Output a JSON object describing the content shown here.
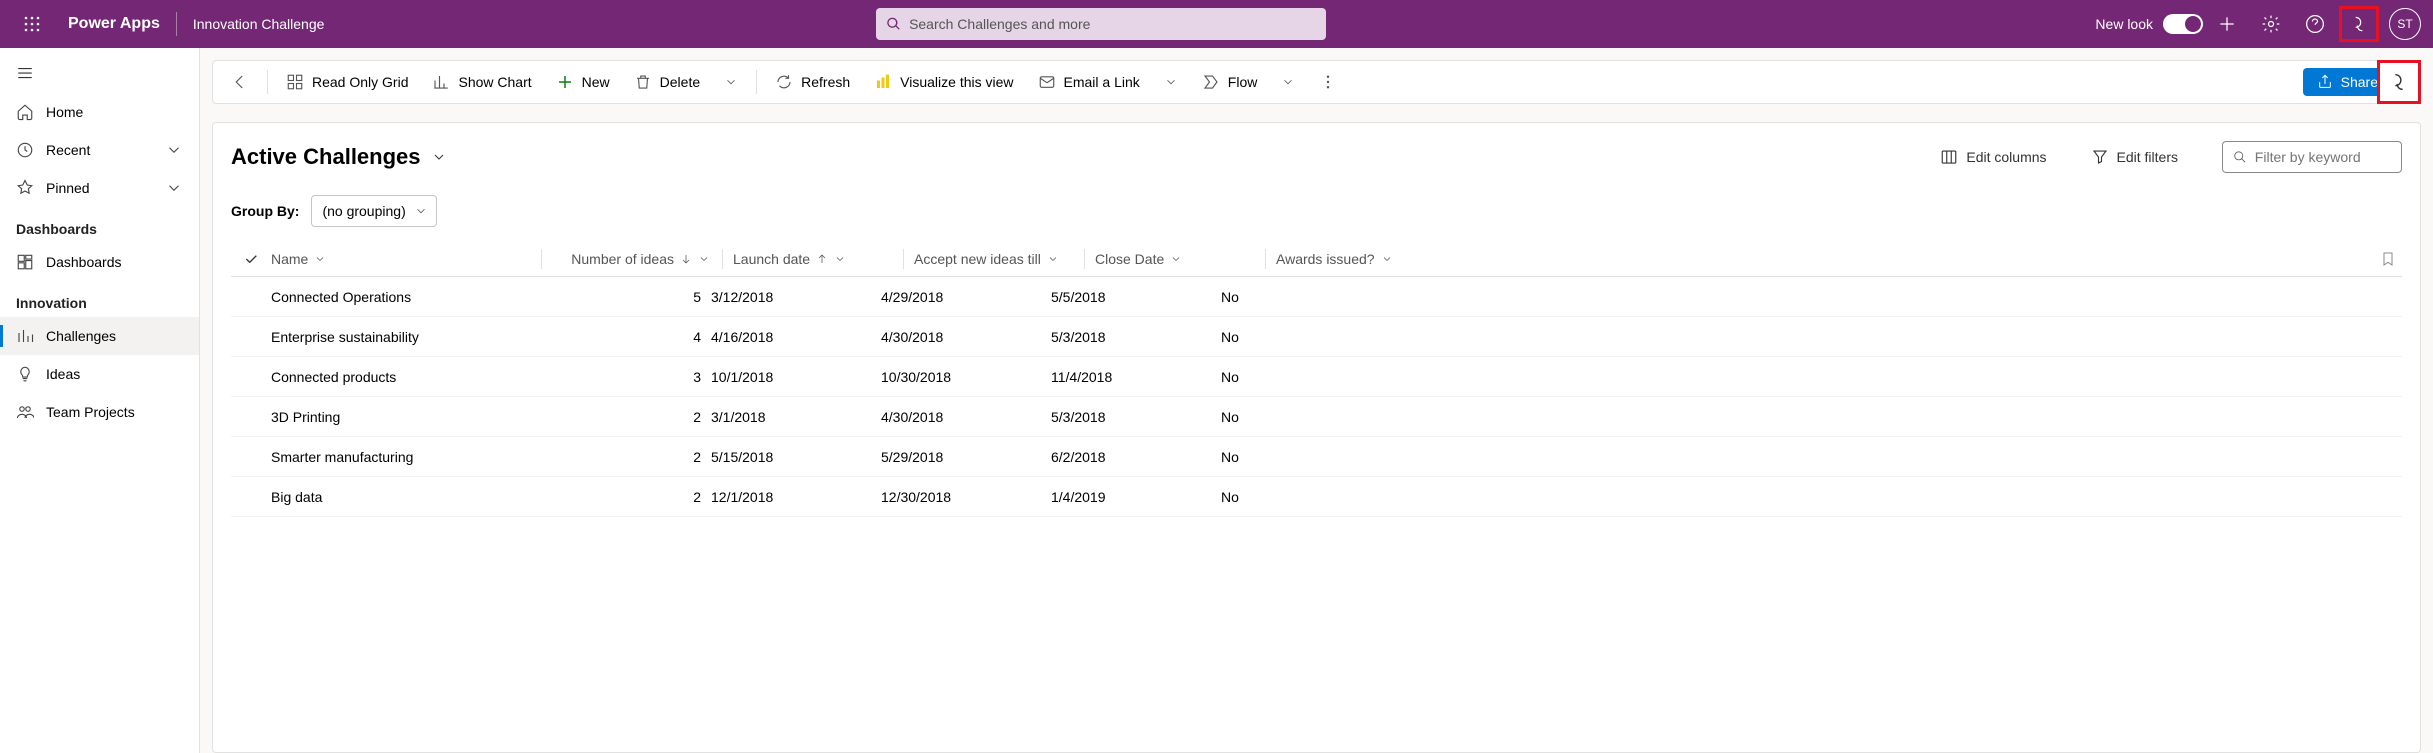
{
  "header": {
    "brand": "Power Apps",
    "app_name": "Innovation Challenge",
    "search_placeholder": "Search Challenges and more",
    "new_look_label": "New look",
    "avatar_initials": "ST"
  },
  "sidebar": {
    "items": [
      {
        "label": "Home"
      },
      {
        "label": "Recent"
      },
      {
        "label": "Pinned"
      }
    ],
    "section_dashboards": "Dashboards",
    "dashboards_item": "Dashboards",
    "section_innovation": "Innovation",
    "innovation_items": [
      {
        "label": "Challenges"
      },
      {
        "label": "Ideas"
      },
      {
        "label": "Team Projects"
      }
    ]
  },
  "commandbar": {
    "read_only_grid": "Read Only Grid",
    "show_chart": "Show Chart",
    "new": "New",
    "delete": "Delete",
    "refresh": "Refresh",
    "visualize": "Visualize this view",
    "email": "Email a Link",
    "flow": "Flow",
    "share": "Share"
  },
  "view": {
    "title": "Active Challenges",
    "edit_columns": "Edit columns",
    "edit_filters": "Edit filters",
    "filter_placeholder": "Filter by keyword",
    "group_by_label": "Group By:",
    "group_by_value": "(no grouping)"
  },
  "grid": {
    "columns": {
      "name": "Name",
      "ideas": "Number of ideas",
      "launch": "Launch date",
      "accept": "Accept new ideas till",
      "close": "Close Date",
      "awards": "Awards issued?"
    },
    "rows": [
      {
        "name": "Connected Operations",
        "ideas": "5",
        "launch": "3/12/2018",
        "accept": "4/29/2018",
        "close": "5/5/2018",
        "awards": "No"
      },
      {
        "name": "Enterprise sustainability",
        "ideas": "4",
        "launch": "4/16/2018",
        "accept": "4/30/2018",
        "close": "5/3/2018",
        "awards": "No"
      },
      {
        "name": "Connected products",
        "ideas": "3",
        "launch": "10/1/2018",
        "accept": "10/30/2018",
        "close": "11/4/2018",
        "awards": "No"
      },
      {
        "name": "3D Printing",
        "ideas": "2",
        "launch": "3/1/2018",
        "accept": "4/30/2018",
        "close": "5/3/2018",
        "awards": "No"
      },
      {
        "name": "Smarter manufacturing",
        "ideas": "2",
        "launch": "5/15/2018",
        "accept": "5/29/2018",
        "close": "6/2/2018",
        "awards": "No"
      },
      {
        "name": "Big data",
        "ideas": "2",
        "launch": "12/1/2018",
        "accept": "12/30/2018",
        "close": "1/4/2019",
        "awards": "No"
      }
    ]
  }
}
